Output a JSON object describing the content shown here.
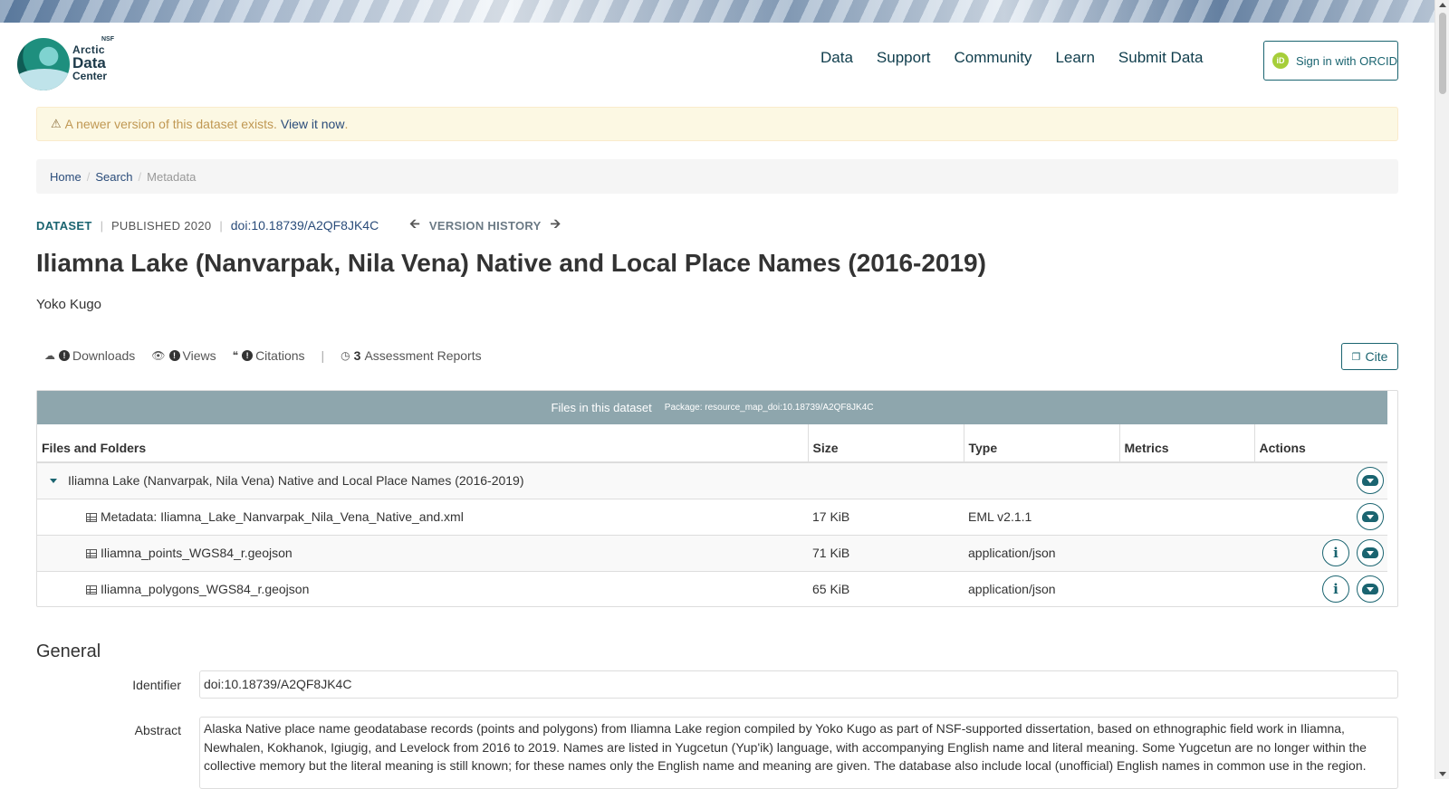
{
  "header": {
    "logo": {
      "nsf": "NSF",
      "line1": "Arctic",
      "line2": "Data",
      "line3": "Center"
    },
    "nav": [
      "Data",
      "Support",
      "Community",
      "Learn",
      "Submit Data"
    ],
    "orcid_icon": "iD",
    "orcid_label": "Sign in with ORCID"
  },
  "alert": {
    "text": "A newer version of this dataset exists.",
    "link": "View it now",
    "trailing": "."
  },
  "breadcrumb": {
    "home": "Home",
    "search": "Search",
    "current": "Metadata"
  },
  "dataset": {
    "label": "DATASET",
    "published": "PUBLISHED 2020",
    "doi": "doi:10.18739/A2QF8JK4C",
    "version_history": "VERSION HISTORY",
    "title": "Iliamna Lake (Nanvarpak, Nila Vena) Native and Local Place Names (2016-2019)",
    "author": "Yoko Kugo"
  },
  "metrics": {
    "downloads": "Downloads",
    "views": "Views",
    "citations": "Citations",
    "assessment_count": "3",
    "assessment_label": "Assessment Reports",
    "cite": "Cite"
  },
  "files": {
    "header": "Files in this dataset",
    "package": "Package: resource_map_doi:10.18739/A2QF8JK4C",
    "columns": [
      "Files and Folders",
      "Size",
      "Type",
      "Metrics",
      "Actions"
    ],
    "package_row": "Iliamna Lake (Nanvarpak, Nila Vena) Native and Local Place Names (2016-2019)",
    "rows": [
      {
        "name": "Metadata: Iliamna_Lake_Nanvarpak_Nila_Vena_Native_and.xml",
        "size": "17 KiB",
        "type": "EML v2.1.1"
      },
      {
        "name": "Iliamna_points_WGS84_r.geojson",
        "size": "71 KiB",
        "type": "application/json"
      },
      {
        "name": "Iliamna_polygons_WGS84_r.geojson",
        "size": "65 KiB",
        "type": "application/json"
      }
    ]
  },
  "general": {
    "heading": "General",
    "identifier_label": "Identifier",
    "identifier": "doi:10.18739/A2QF8JK4C",
    "abstract_label": "Abstract",
    "abstract": "Alaska Native place name geodatabase records (points and polygons) from Iliamna Lake region compiled by Yoko Kugo as part of NSF-supported dissertation, based on ethnographic field work in Iliamna, Newhalen, Kokhanok, Igiugig, and Levelock from 2016 to 2019. Names are listed in Yugcetun (Yup'ik) language, with accompanying English name and literal meaning. Some Yugcetun are no longer within the collective memory but the literal meaning is still known; for these names only the English name and meaning are given. The database also include local (unofficial) English names in common use in the region."
  },
  "colors": {
    "accent": "#1a6470",
    "link": "#2a4c7a",
    "alert_bg": "#fcf8e3",
    "table_header": "#8ea6ad"
  }
}
